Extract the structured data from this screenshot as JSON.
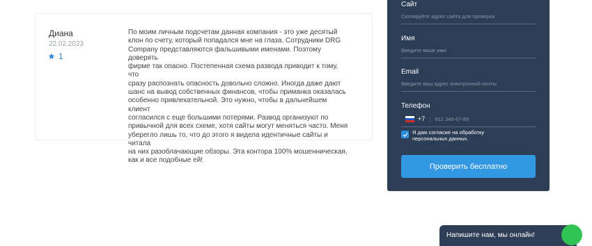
{
  "review": {
    "author": "Диана",
    "date": "22.02.2023",
    "rating": "1",
    "text_lines": [
      "По моим личным подсчетам данная компания - это уже десятый",
      "клон по счету, который попадался мне на глаза. Сотрудники DRG",
      "Company представляются фальшивыми именами. Поэтому доверять",
      "фирме так опасно. Постепенная схема развода приводит к тому, что",
      "сразу распознать опасность довольно сложно. Иногда даже дают",
      "шанс на вывод собственных финансов, чтобы приманка оказалась",
      "особенно привлекательной. Это нужно, чтобы в дальнейшем клиент",
      "согласился с еще большими потерями. Развод организуют по",
      "привычной для всех схеме, хотя сайты могут меняться часто. Меня",
      "уберегло лишь то, что до этого я видела идентичные сайты и читала",
      "на них разоблачающие обзоры. Эта контора 100% мошенническая,",
      "как и все подобные ей!"
    ]
  },
  "form": {
    "site": {
      "label": "Сайт",
      "placeholder": "Скопируйте адрес сайта для проверки"
    },
    "name": {
      "label": "Имя",
      "placeholder": "Введите ваше имя"
    },
    "email": {
      "label": "Email",
      "placeholder": "Введите ваш адрес электронной почты"
    },
    "phone": {
      "label": "Телефон",
      "code": "+7",
      "placeholder": "912 345-67-89"
    },
    "consent": "Я даю согласие на обработку персональных данных.",
    "submit": "Проверить бесплатно"
  },
  "chat": {
    "text": "Напишите нам, мы онлайн!"
  },
  "colors": {
    "panel": "#2c3e56",
    "accent": "#3398e4",
    "star": "#2f86d6",
    "chat_green": "#31c455"
  },
  "icons": {
    "rating": "star-icon",
    "flag": "russia-flag-icon",
    "consent": "check-icon"
  }
}
